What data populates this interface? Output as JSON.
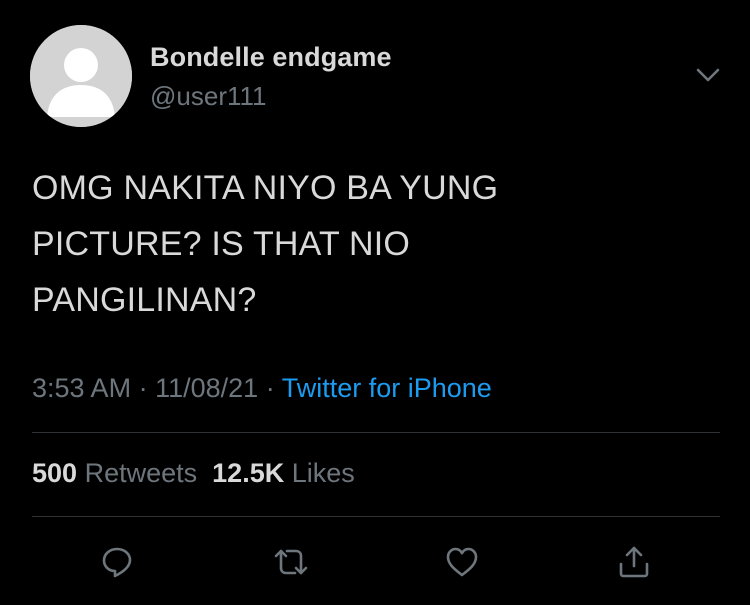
{
  "author": {
    "display_name": "Bondelle endgame",
    "handle": "@user111"
  },
  "tweet": {
    "lines": [
      "OMG NAKITA NIYO BA YUNG",
      "PICTURE? IS THAT NIO",
      "PANGILINAN?"
    ],
    "time": "3:53 AM",
    "date": "11/08/21",
    "separator": "·",
    "source": "Twitter for iPhone"
  },
  "stats": {
    "retweets_count": "500",
    "retweets_label": "Retweets",
    "likes_count": "12.5K",
    "likes_label": "Likes"
  },
  "icons": {
    "more": "chevron-down-icon",
    "reply": "reply-icon",
    "retweet": "retweet-icon",
    "like": "heart-icon",
    "share": "share-icon"
  },
  "colors": {
    "background": "#000000",
    "text": "#d9d9d9",
    "muted": "#6e767d",
    "link": "#1d9bf0",
    "divider": "#2f3336",
    "avatar_bg": "#d3d3d3"
  }
}
